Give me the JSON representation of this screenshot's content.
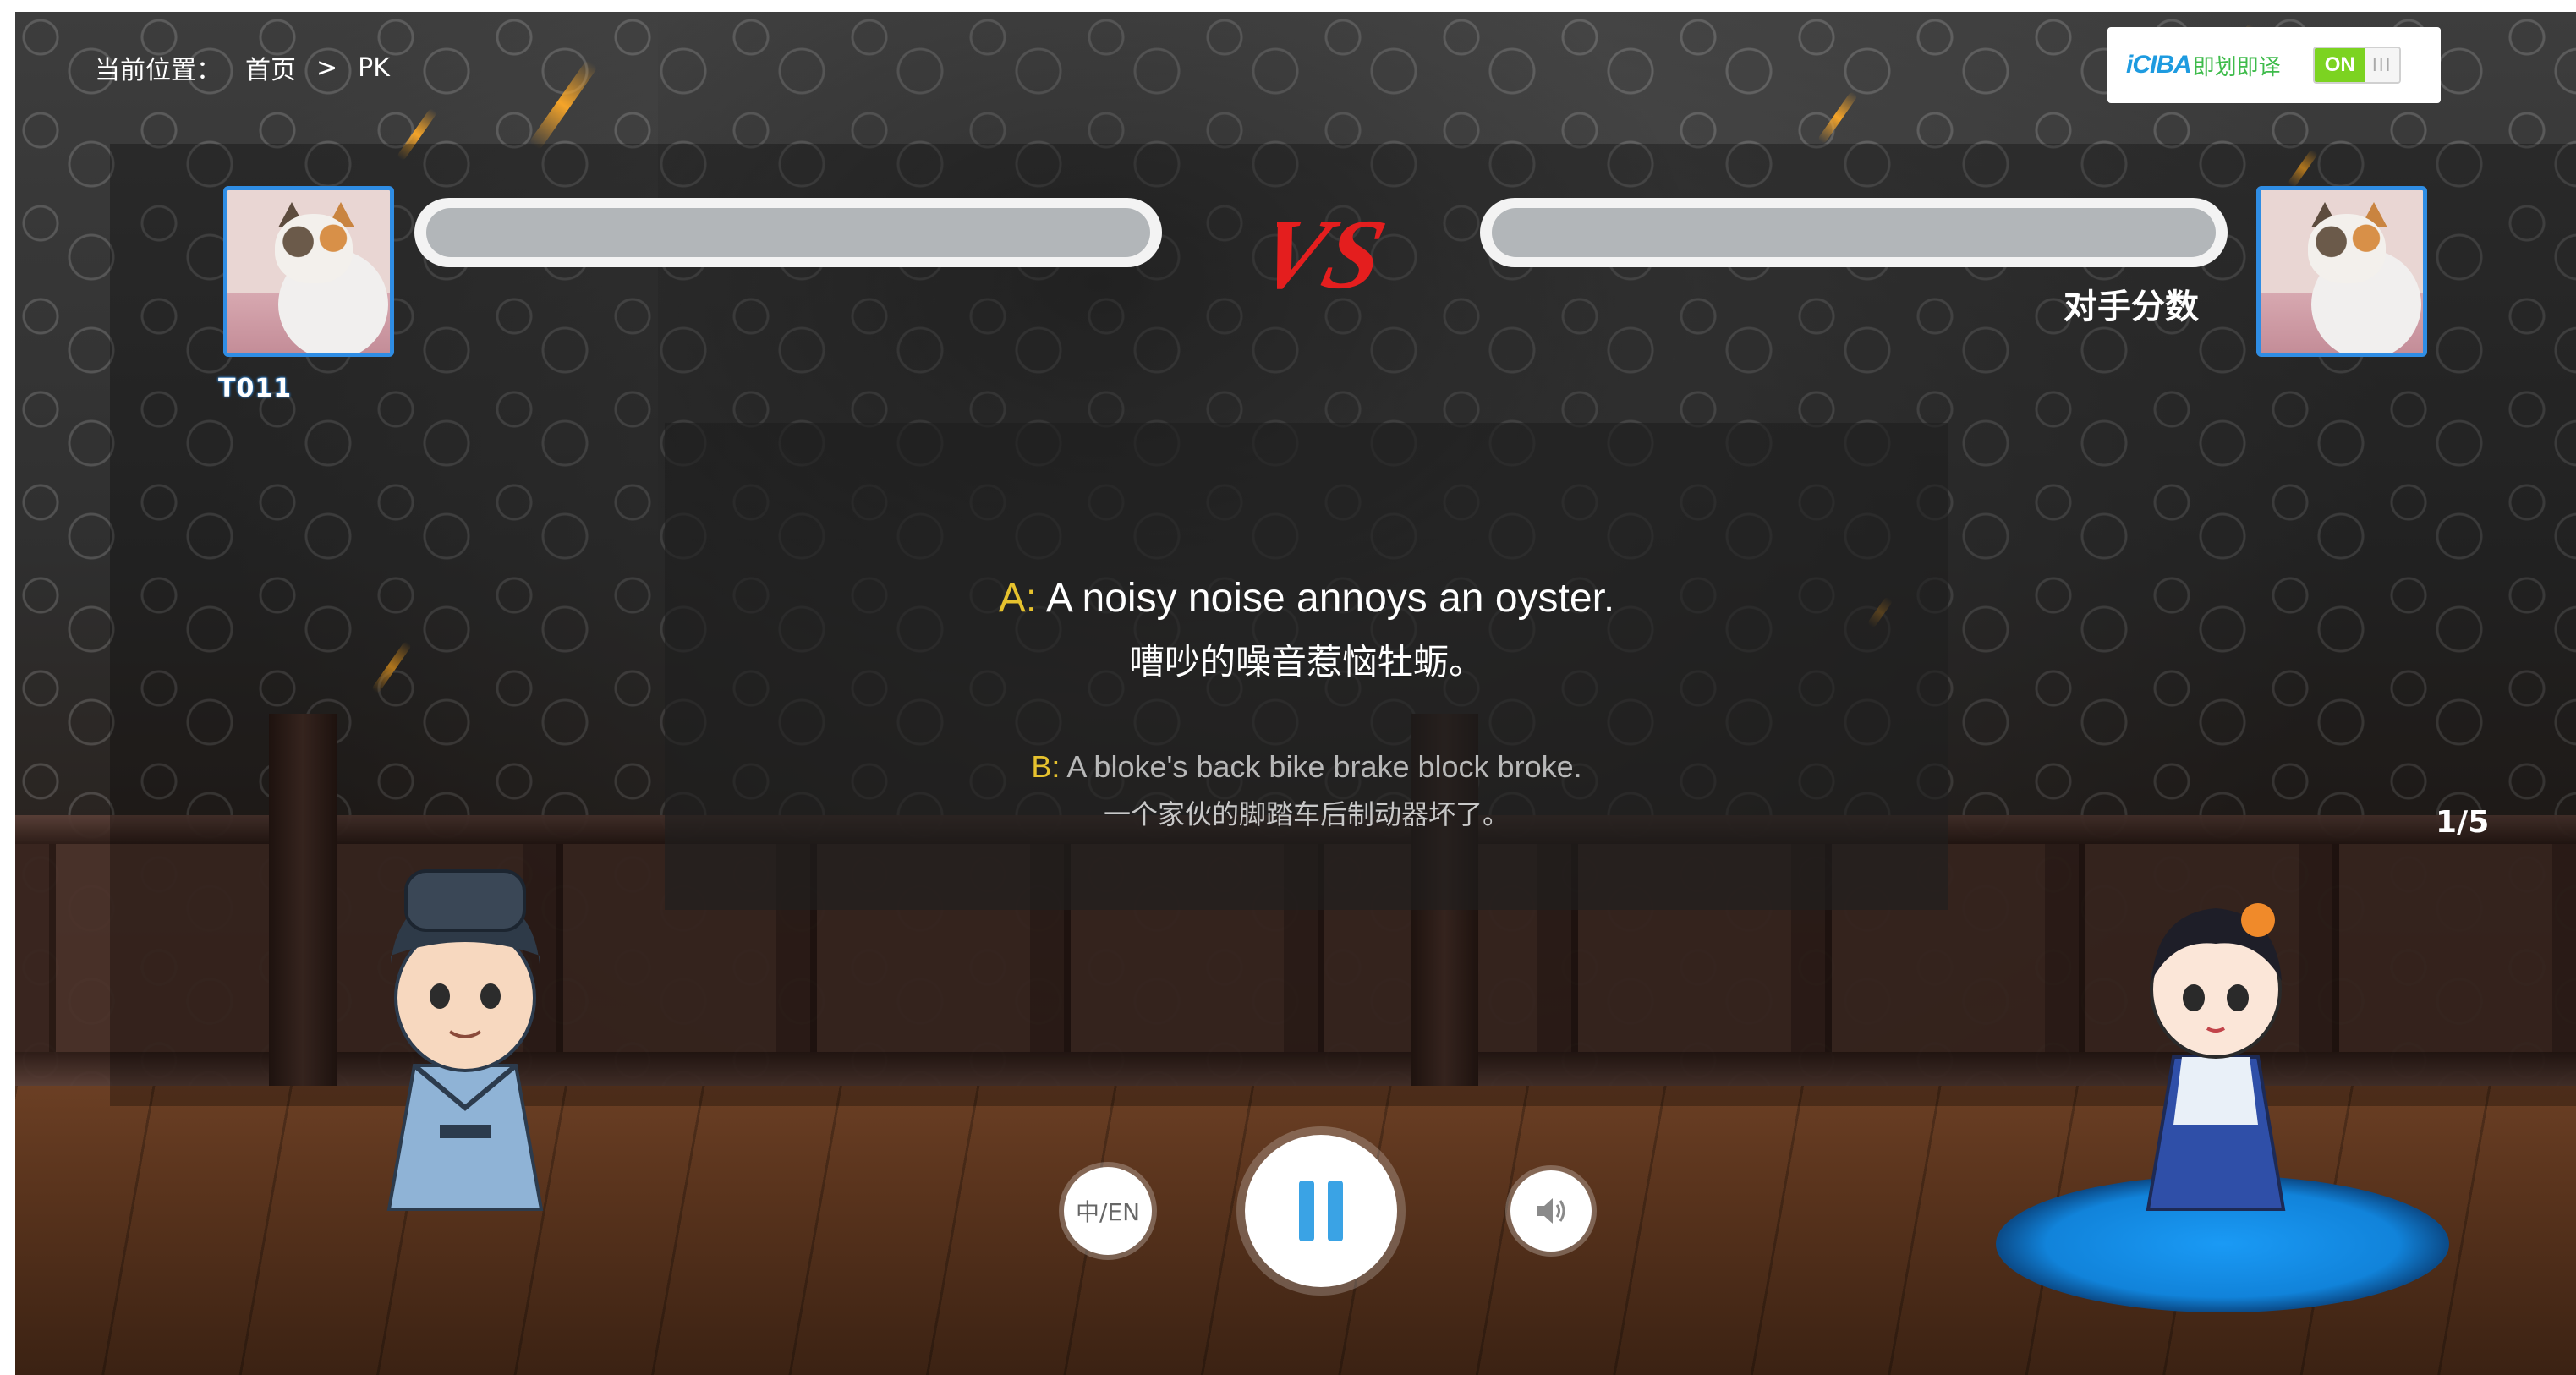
{
  "breadcrumb": {
    "label": "当前位置：",
    "home": "首页",
    "separator": ">",
    "current": "PK"
  },
  "iciba": {
    "logo": "iCIBA",
    "text": "即划即译",
    "toggle_state": "ON",
    "grip": "III"
  },
  "players": {
    "self": {
      "name": "T011",
      "score_fraction": 0
    },
    "opponent": {
      "label": "对手分数",
      "score_fraction": 0
    }
  },
  "vs_text": "VS",
  "question": {
    "a": {
      "tag": "A:",
      "en": "A noisy noise annoys an oyster.",
      "zh": "嘈吵的噪音惹恼牡蛎。"
    },
    "b": {
      "tag": "B:",
      "en": "A bloke's back bike brake block broke.",
      "zh": "一个家伙的脚踏车后制动器坏了。"
    }
  },
  "progress": "1/5",
  "controls": {
    "language_label": "中/EN",
    "pause_icon": "pause-icon",
    "sound_icon": "speaker-icon"
  },
  "colors": {
    "accent_blue": "#2f8de4",
    "tag_yellow": "#e6c22e",
    "vs_red": "#e41e1e",
    "toggle_green": "#7cd321"
  }
}
